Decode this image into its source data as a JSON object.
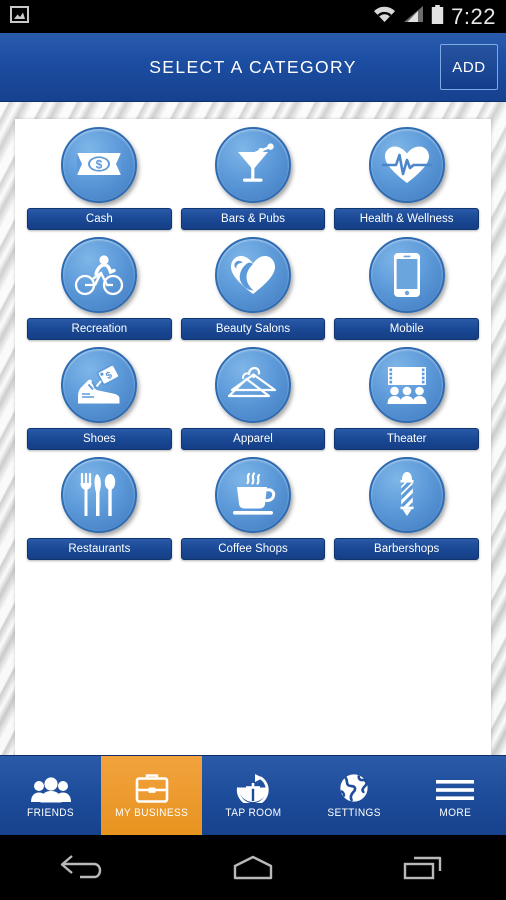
{
  "status_bar": {
    "notification_icon": "image-notification-icon",
    "wifi_icon": "wifi-icon",
    "signal_icon": "cellular-signal-icon",
    "battery_icon": "battery-icon",
    "time": "7:22"
  },
  "header": {
    "title": "SELECT A CATEGORY",
    "add_label": "ADD"
  },
  "categories": [
    {
      "label": "Cash",
      "icon": "money-bill-icon"
    },
    {
      "label": "Bars & Pubs",
      "icon": "martini-glass-icon"
    },
    {
      "label": "Health & Wellness",
      "icon": "heart-pulse-icon"
    },
    {
      "label": "Recreation",
      "icon": "bicycle-rider-icon"
    },
    {
      "label": "Beauty Salons",
      "icon": "heart-face-icon"
    },
    {
      "label": "Mobile",
      "icon": "smartphone-icon"
    },
    {
      "label": "Shoes",
      "icon": "sneaker-tag-icon"
    },
    {
      "label": "Apparel",
      "icon": "clothes-hanger-icon"
    },
    {
      "label": "Theater",
      "icon": "cinema-screen-icon"
    },
    {
      "label": "Restaurants",
      "icon": "cutlery-icon"
    },
    {
      "label": "Coffee Shops",
      "icon": "coffee-cup-icon"
    },
    {
      "label": "Barbershops",
      "icon": "barber-pole-icon"
    }
  ],
  "bottom_nav": {
    "active_index": 1,
    "items": [
      {
        "label": "FRIENDS",
        "icon": "people-group-icon"
      },
      {
        "label": "MY BUSINESS",
        "icon": "briefcase-icon"
      },
      {
        "label": "TAP ROOM",
        "icon": "tap-room-g-arrow-icon"
      },
      {
        "label": "SETTINGS",
        "icon": "globe-icon"
      },
      {
        "label": "MORE",
        "icon": "hamburger-menu-icon"
      }
    ]
  },
  "system_nav": {
    "back": "back-arrow-icon",
    "home": "home-icon",
    "recents": "recent-apps-icon"
  },
  "colors": {
    "header_blue": "#1d4fa4",
    "circle_blue": "#5d9ad9",
    "label_blue": "#1b4a96",
    "active_orange": "#ec9a2e",
    "status_black": "#000000"
  }
}
